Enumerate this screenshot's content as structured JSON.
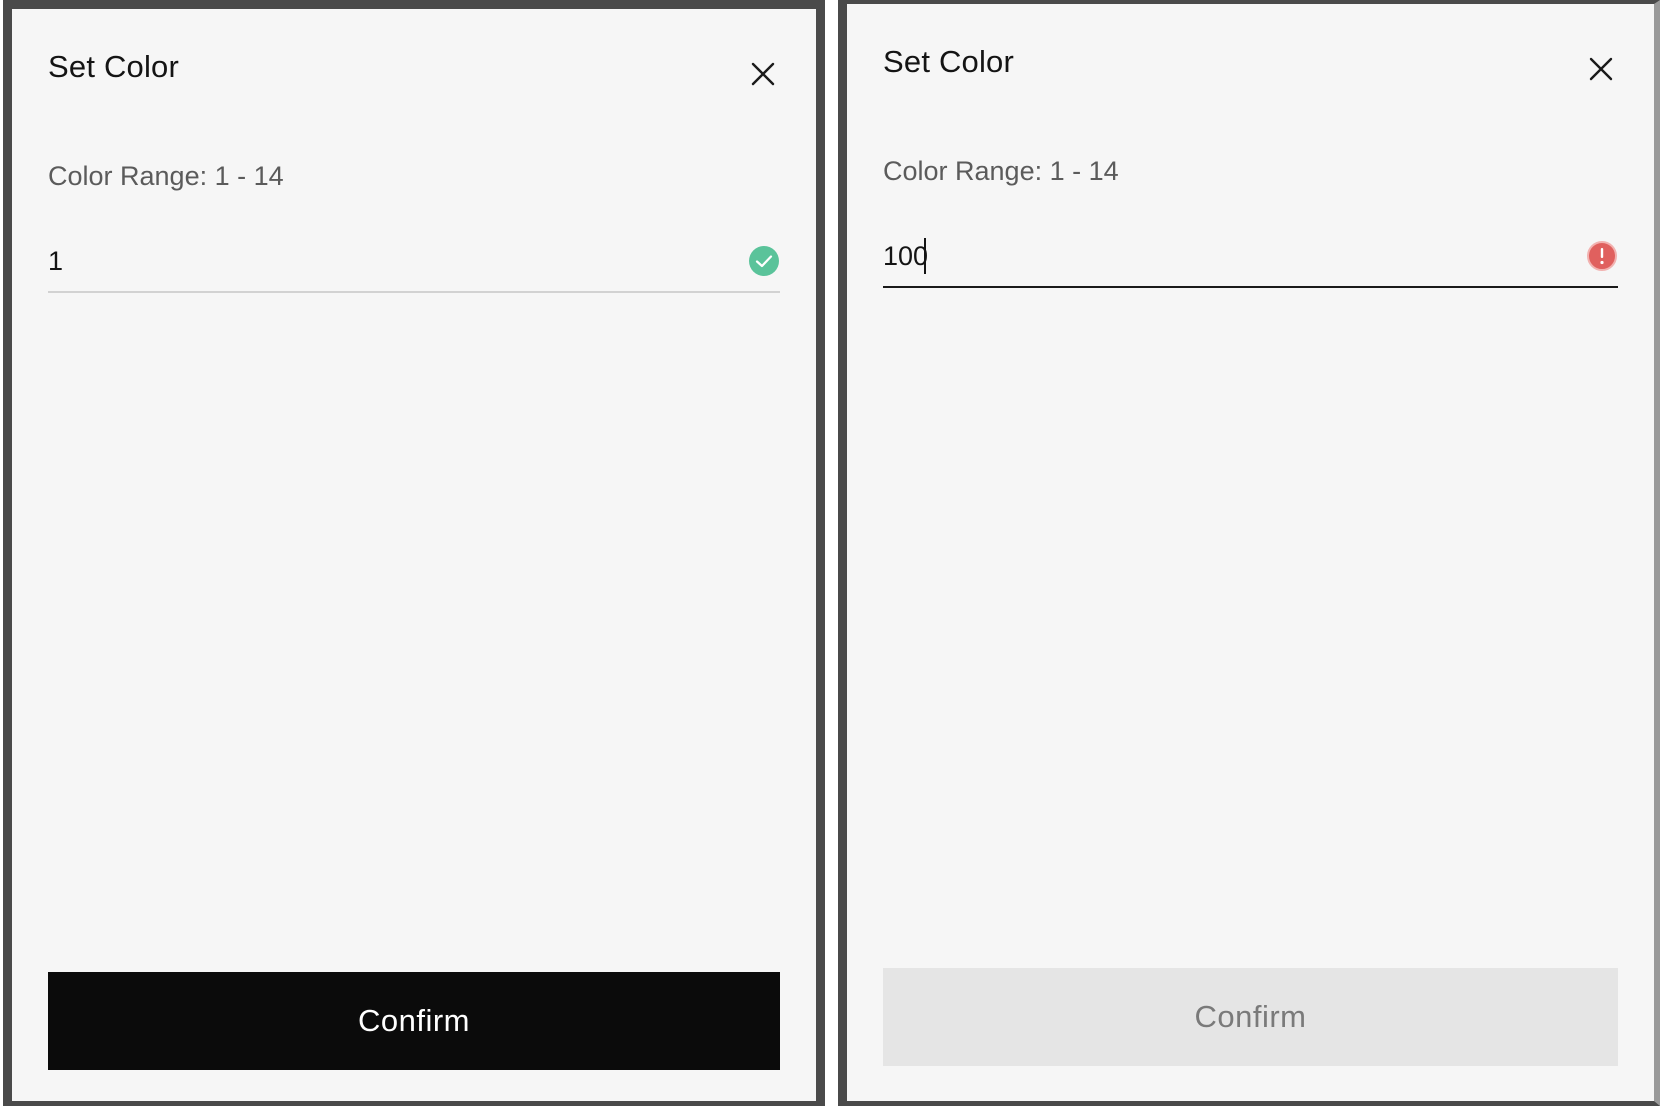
{
  "panels": [
    {
      "title": "Set Color",
      "range_label": "Color Range: 1 - 14",
      "input_value": "1",
      "status": "valid",
      "status_icon": "check-circle-icon",
      "status_color": "#5ac39a",
      "underline_color": "#d2d2d2",
      "confirm_label": "Confirm",
      "confirm_state": "enabled"
    },
    {
      "title": "Set Color",
      "range_label": "Color Range: 1 - 14",
      "input_value": "100",
      "status": "error",
      "status_icon": "error-circle-icon",
      "status_color": "#e0605e",
      "underline_color": "#1a1a1a",
      "confirm_label": "Confirm",
      "confirm_state": "disabled"
    }
  ]
}
